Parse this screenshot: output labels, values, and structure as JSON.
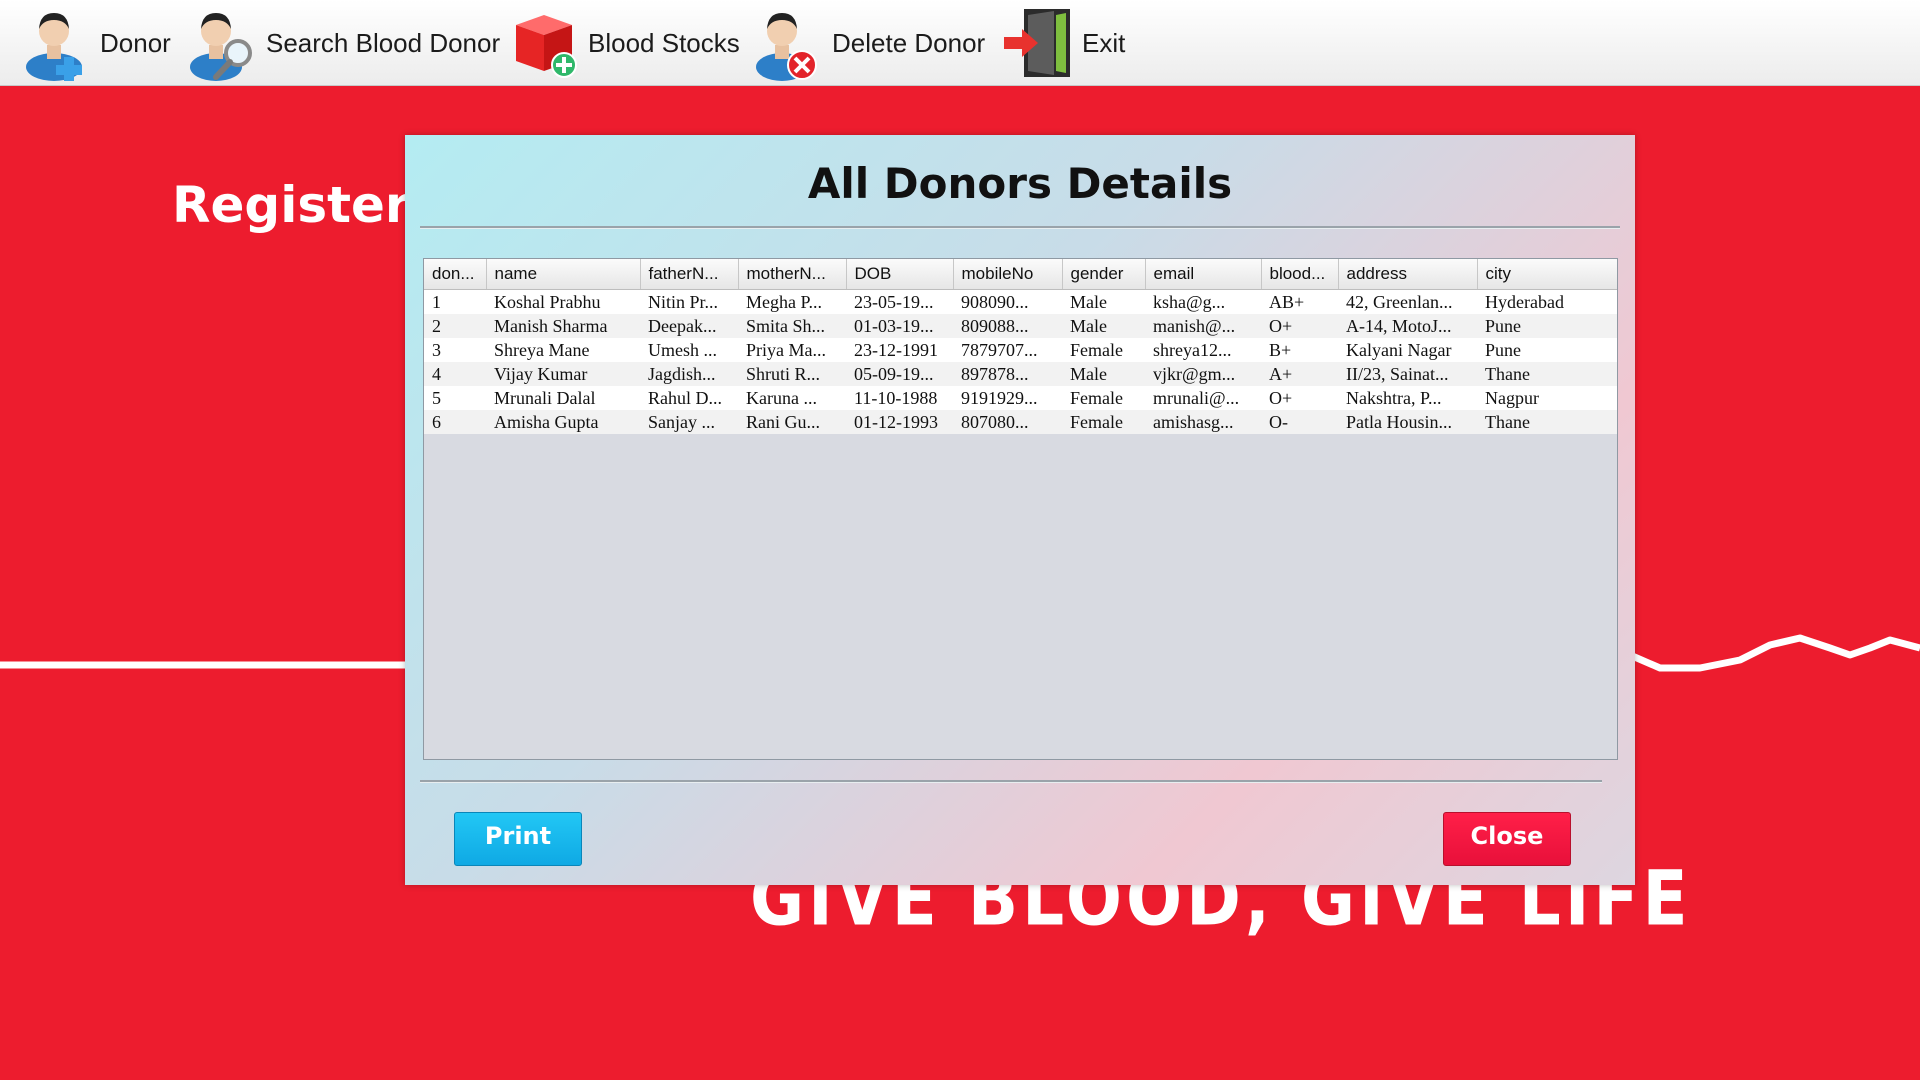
{
  "colors": {
    "background": "#ed1c2e",
    "print_button": "#15b4ee",
    "close_button": "#f21440",
    "dialog_gradient_start": "#b4ecf2",
    "dialog_gradient_end": "#f0c8d2"
  },
  "toolbar": {
    "items": [
      {
        "label": "Donor",
        "icon": "add-user-icon"
      },
      {
        "label": "Search Blood Donor",
        "icon": "search-user-icon"
      },
      {
        "label": "Blood Stocks",
        "icon": "add-box-icon"
      },
      {
        "label": "Delete Donor",
        "icon": "delete-user-icon"
      },
      {
        "label": "Exit",
        "icon": "exit-door-icon"
      }
    ]
  },
  "background": {
    "heading": "Register f",
    "tagline": "GIVE BLOOD, GIVE LIFE"
  },
  "dialog": {
    "title": "All Donors Details",
    "print_label": "Print",
    "close_label": "Close",
    "table": {
      "columns": [
        "don...",
        "name",
        "fatherN...",
        "motherN...",
        "DOB",
        "mobileNo",
        "gender",
        "email",
        "blood...",
        "address",
        "city"
      ],
      "rows": [
        [
          "1",
          "Koshal Prabhu",
          "Nitin Pr...",
          "Megha P...",
          "23-05-19...",
          "908090...",
          "Male",
          "ksha@g...",
          "AB+",
          "42, Greenlan...",
          "Hyderabad"
        ],
        [
          "2",
          "Manish Sharma",
          "Deepak...",
          "Smita Sh...",
          "01-03-19...",
          "809088...",
          "Male",
          "manish@...",
          "O+",
          "A-14, MotoJ...",
          "Pune"
        ],
        [
          "3",
          "Shreya Mane",
          "Umesh ...",
          "Priya Ma...",
          "23-12-1991",
          "7879707...",
          "Female",
          "shreya12...",
          "B+",
          "Kalyani Nagar",
          "Pune"
        ],
        [
          "4",
          "Vijay Kumar",
          "Jagdish...",
          "Shruti R...",
          "05-09-19...",
          "897878...",
          "Male",
          "vjkr@gm...",
          "A+",
          "II/23, Sainat...",
          "Thane"
        ],
        [
          "5",
          "Mrunali Dalal",
          "Rahul D...",
          "Karuna ...",
          "11-10-1988",
          "9191929...",
          "Female",
          "mrunali@...",
          "O+",
          "Nakshtra, P...",
          "Nagpur"
        ],
        [
          "6",
          "Amisha Gupta",
          "Sanjay ...",
          "Rani Gu...",
          "01-12-1993",
          "807080...",
          "Female",
          "amishasg...",
          "O-",
          "Patla Housin...",
          "Thane"
        ]
      ]
    }
  }
}
